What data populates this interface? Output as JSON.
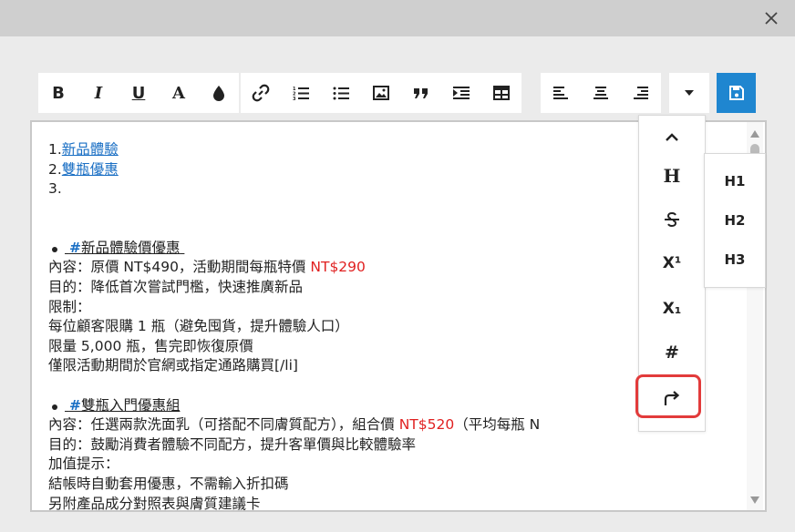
{
  "toolbar": {
    "bold": "B",
    "italic": "I",
    "underline": "U",
    "font_color": "A",
    "save_color": "#1f86d0"
  },
  "editor": {
    "numbered": [
      {
        "num": "1.",
        "text": "新品體驗"
      },
      {
        "num": "2.",
        "text": "雙瓶優惠"
      },
      {
        "num": "3.",
        "text": ""
      }
    ],
    "sections": [
      {
        "hash": "#",
        "tag": "新品體驗價優惠",
        "lines": [
          {
            "text": "內容：原價 NT$490，活動期間每瓶特價 ",
            "red": "NT$290",
            "tail": ""
          },
          {
            "text": "目的：降低首次嘗試門檻，快速推廣新品",
            "red": "",
            "tail": ""
          },
          {
            "text": "限制：",
            "red": "",
            "tail": ""
          },
          {
            "text": "每位顧客限購 1 瓶（避免囤貨，提升體驗人口）",
            "red": "",
            "tail": ""
          },
          {
            "text": "限量 5,000 瓶，售完即恢復原價",
            "red": "",
            "tail": ""
          },
          {
            "text": "僅限活動期間於官網或指定通路購買[/li]",
            "red": "",
            "tail": ""
          }
        ]
      },
      {
        "hash": "#",
        "tag": "雙瓶入門優惠組",
        "lines": [
          {
            "text": "內容：任選兩款洗面乳（可搭配不同膚質配方），組合價 ",
            "red": "NT$520",
            "tail": "（平均每瓶 N"
          },
          {
            "text": "目的：鼓勵消費者體驗不同配方，提升客單價與比較體驗率",
            "red": "",
            "tail": ""
          },
          {
            "text": "加值提示：",
            "red": "",
            "tail": ""
          },
          {
            "text": "結帳時自動套用優惠，不需輸入折扣碼",
            "red": "",
            "tail": ""
          },
          {
            "text": "另附產品成分對照表與膚質建議卡",
            "red": "",
            "tail": ""
          }
        ]
      }
    ]
  },
  "more_menu": {
    "heading": "H",
    "superscript": "X¹",
    "subscript": "X₁",
    "hash": "#"
  },
  "heading_menu": [
    "H1",
    "H2",
    "H3"
  ]
}
